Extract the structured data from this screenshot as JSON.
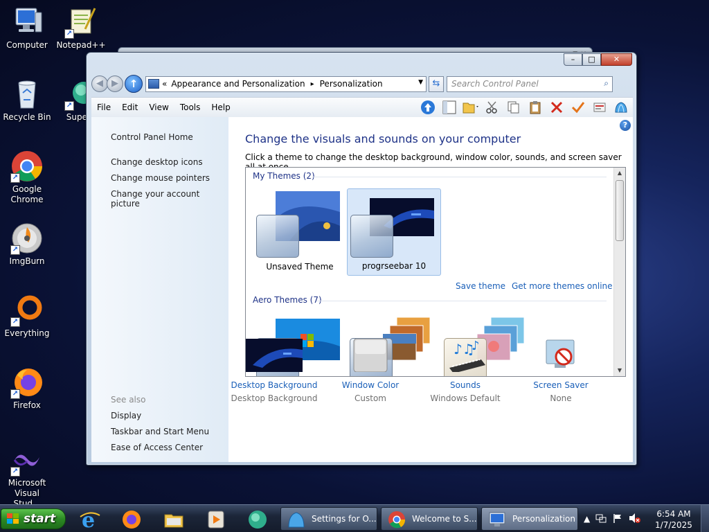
{
  "desktop": {
    "icons": [
      {
        "label": "Computer"
      },
      {
        "label": "Notepad++"
      },
      {
        "label": "Recycle Bin"
      },
      {
        "label": "Supern"
      },
      {
        "label": "Google Chrome"
      },
      {
        "label": "ImgBurn"
      },
      {
        "label": "Everything"
      },
      {
        "label": "Firefox"
      },
      {
        "label": "Microsoft Visual Stud..."
      }
    ]
  },
  "window": {
    "controls": {
      "minimize": "–",
      "maximize": "□",
      "close": "✕"
    },
    "address": {
      "prefix": "«",
      "crumbs": [
        "Appearance and Personalization",
        "Personalization"
      ],
      "separator": "▸"
    },
    "search": {
      "placeholder": "Search Control Panel"
    },
    "menu": [
      "File",
      "Edit",
      "View",
      "Tools",
      "Help"
    ]
  },
  "left_pane": {
    "home": "Control Panel Home",
    "links": [
      "Change desktop icons",
      "Change mouse pointers",
      "Change your account picture"
    ],
    "see_also_title": "See also",
    "see_also": [
      "Display",
      "Taskbar and Start Menu",
      "Ease of Access Center"
    ]
  },
  "main": {
    "title": "Change the visuals and sounds on your computer",
    "description": "Click a theme to change the desktop background, window color, sounds, and screen saver all at once.",
    "my_themes": {
      "title": "My Themes (2)",
      "items": [
        {
          "name": "Unsaved Theme",
          "selected": false
        },
        {
          "name": "progrseebar 10",
          "selected": true
        }
      ]
    },
    "save_theme": "Save theme",
    "get_more": "Get more themes online",
    "aero_themes": {
      "title": "Aero Themes (7)"
    },
    "bottom": [
      {
        "label": "Desktop Background",
        "sub": "Desktop Background",
        "icon": "desktop-background-icon"
      },
      {
        "label": "Window Color",
        "sub": "Custom",
        "icon": "window-color-icon"
      },
      {
        "label": "Sounds",
        "sub": "Windows Default",
        "icon": "sounds-icon"
      },
      {
        "label": "Screen Saver",
        "sub": "None",
        "icon": "screen-saver-icon"
      }
    ]
  },
  "taskbar": {
    "start_label": "start",
    "tasks": [
      {
        "label": "Settings for O..."
      },
      {
        "label": "Welcome to S..."
      },
      {
        "label": "Personalization"
      }
    ],
    "tray_expand": "▲",
    "time": "6:54 AM",
    "date": "1/7/2025"
  },
  "colors": {
    "link": "#1a5fb8",
    "title": "#1e3287",
    "selection": "#d8e7f9"
  }
}
